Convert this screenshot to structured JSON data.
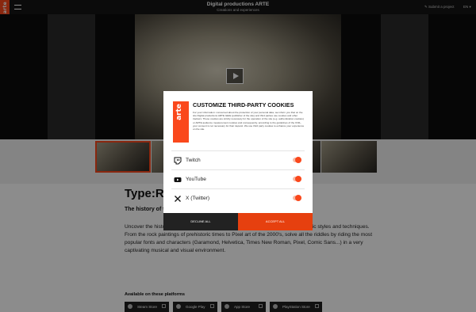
{
  "header": {
    "brand": "arte",
    "title": "Digital productions ARTE",
    "subtitle": "Creations and experiences",
    "submit_link": "Submit a project",
    "language": "EN"
  },
  "game": {
    "title": "Type:Rid",
    "tagline": "The history of typ",
    "description": "Uncover the histo                                                                                 rience! Play as 2 dots and travel through the ages of typographic styles and techniques. From the rock paintings of prehistoric times to Pixel art of the 2000's, solve all the riddles by riding the most popular fonts and characters (Garamond, Helvetica, Times New Roman, Pixel, Comic Sans...) in a very captivating musical and visual environment.",
    "platforms_title": "Available on these platforms",
    "stores": [
      "Steam Store",
      "Google Play",
      "App Store",
      "PlayStation Store"
    ]
  },
  "cookie_modal": {
    "logo": "arte",
    "title": "CUSTOMIZE THIRD-PARTY COOKIES",
    "description": "For your information: concerned about the protection of your personal data, we inform you that on the site Digital productions ARTE GEIE (publisher of the site) and third parties use cookies and other trackers. These cookies are strictly necessary for the operation of the site (e.g. authentication cookies) or ARTE audience measurement cookies and consequently, according to the guidelines of the CNIL, your consent is not necessary for their deposit. We use third party cookies to enhance your experience on the site.",
    "items": [
      {
        "label": "Twitch",
        "icon": "twitch-icon",
        "enabled": true
      },
      {
        "label": "YouTube",
        "icon": "youtube-icon",
        "enabled": true
      },
      {
        "label": "X (Twitter)",
        "icon": "x-icon",
        "enabled": true
      }
    ],
    "decline_label": "DECLINE ALL",
    "accept_label": "ACCEPT ALL"
  },
  "colors": {
    "brand": "#fa481c",
    "header_bg": "#141414",
    "decline_bg": "#222222",
    "accept_bg": "#e6400f"
  }
}
